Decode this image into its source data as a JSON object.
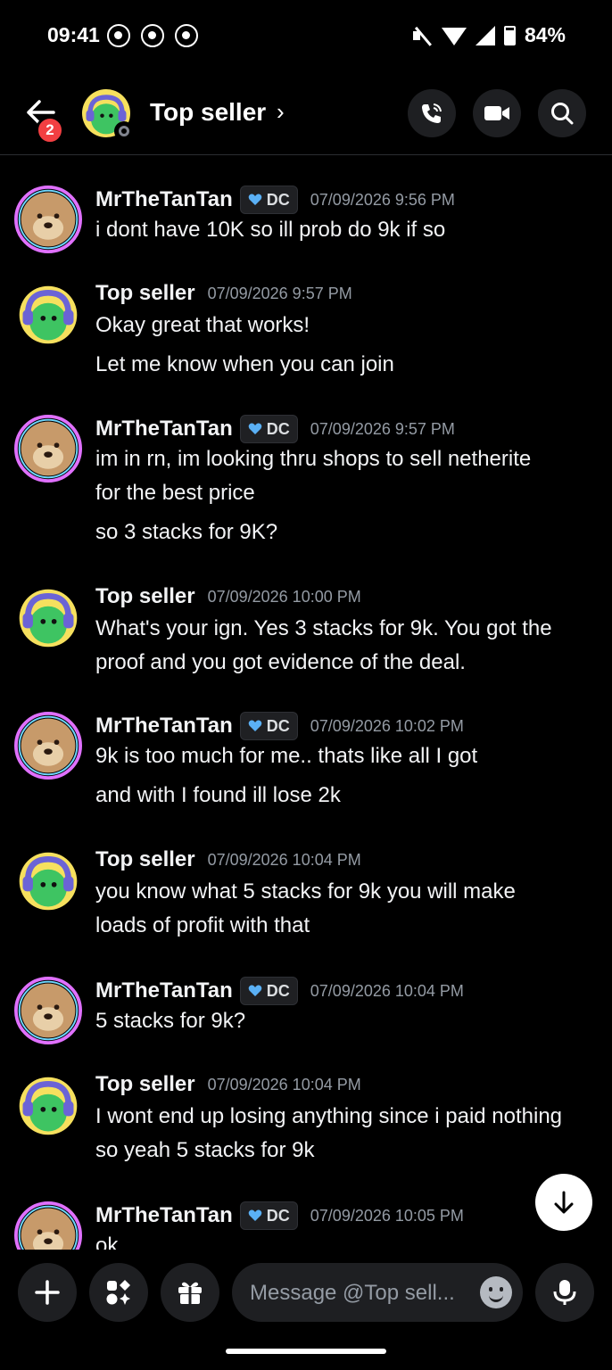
{
  "status_bar": {
    "time": "09:41",
    "battery": "84%"
  },
  "header": {
    "badge_count": "2",
    "title": "Top seller",
    "chevron": "›",
    "icons": [
      "back-arrow-icon",
      "phone-call-icon",
      "video-camera-icon",
      "search-icon"
    ]
  },
  "messages": [
    {
      "author": "MrTheTanTan",
      "tag": "DC",
      "timestamp": "07/09/2026 9:56 PM",
      "lines": [
        "i dont have 10K so ill prob do 9k if so"
      ]
    },
    {
      "author": "Top seller",
      "tag": "",
      "timestamp": "07/09/2026 9:57 PM",
      "lines": [
        "Okay great that works!",
        "Let me know when you can join"
      ]
    },
    {
      "author": "MrTheTanTan",
      "tag": "DC",
      "timestamp": "07/09/2026 9:57 PM",
      "lines": [
        "im in rn, im looking thru shops to sell netherite",
        "for the best price",
        "so 3 stacks for 9K?"
      ]
    },
    {
      "author": "Top seller",
      "tag": "",
      "timestamp": "07/09/2026 10:00 PM",
      "lines": [
        "What's your ign. Yes 3 stacks for 9k. You got the",
        "proof and you got evidence of the deal."
      ]
    },
    {
      "author": "MrTheTanTan",
      "tag": "DC",
      "timestamp": "07/09/2026 10:02 PM",
      "lines": [
        "9k is too much for me.. thats like all I got",
        "and with I found ill lose 2k"
      ]
    },
    {
      "author": "Top seller",
      "tag": "",
      "timestamp": "07/09/2026 10:04 PM",
      "lines": [
        "you know what 5 stacks for 9k you will make",
        "loads of profit with that"
      ]
    },
    {
      "author": "MrTheTanTan",
      "tag": "DC",
      "timestamp": "07/09/2026 10:04 PM",
      "lines": [
        "5 stacks for 9k?"
      ]
    },
    {
      "author": "Top seller",
      "tag": "",
      "timestamp": "07/09/2026 10:04 PM",
      "lines": [
        "I wont end up losing anything since i paid nothing",
        "so yeah 5 stacks for 9k"
      ]
    },
    {
      "author": "MrTheTanTan",
      "tag": "DC",
      "timestamp": "07/09/2026 10:05 PM",
      "lines": [
        "ok"
      ]
    }
  ],
  "composer": {
    "placeholder": "Message @Top sell...",
    "icons": [
      "plus-icon",
      "apps-icon",
      "gift-icon",
      "emoji-icon",
      "microphone-icon"
    ]
  },
  "colors": {
    "background": "#000000",
    "surface": "#1e1f22",
    "timestamp": "#949ba4",
    "badge": "#f23f42",
    "dc_heart": "#5ab0f5"
  }
}
